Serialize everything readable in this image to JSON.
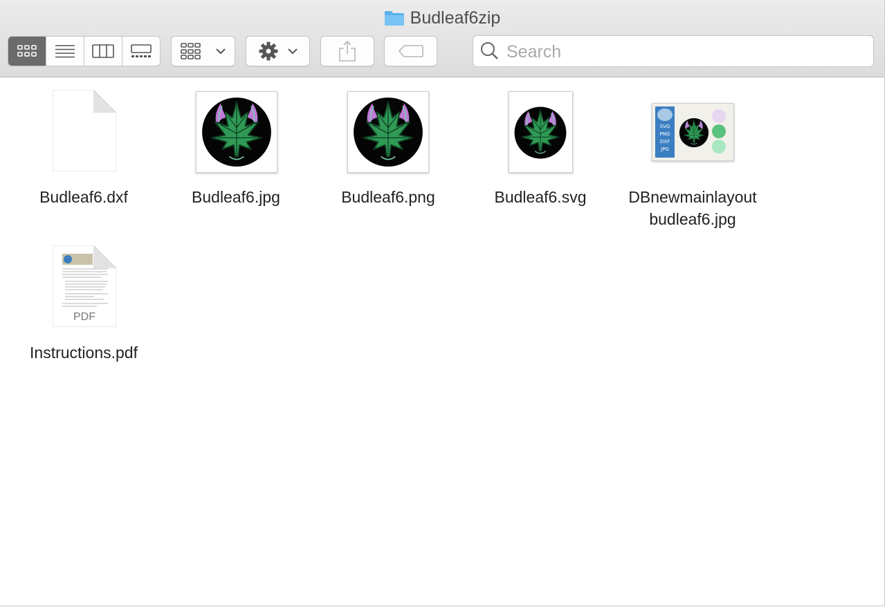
{
  "window": {
    "title": "Budleaf6zip"
  },
  "toolbar": {
    "view_modes": [
      {
        "name": "icon-view",
        "active": true
      },
      {
        "name": "list-view",
        "active": false
      },
      {
        "name": "column-view",
        "active": false
      },
      {
        "name": "gallery-view",
        "active": false
      }
    ],
    "group_button_icon": "grid-icon",
    "action_button_icon": "gear-icon",
    "share_button_icon": "share-icon",
    "tag_button_icon": "tag-icon"
  },
  "search": {
    "placeholder": "Search",
    "value": ""
  },
  "files": [
    {
      "name": "Budleaf6.dxf",
      "kind": "blank-document"
    },
    {
      "name": "Budleaf6.jpg",
      "kind": "leaf-image"
    },
    {
      "name": "Budleaf6.png",
      "kind": "leaf-image"
    },
    {
      "name": "Budleaf6.svg",
      "kind": "leaf-image"
    },
    {
      "name_line1": "DBnewmainlayout",
      "name_line2": "budleaf6.jpg",
      "kind": "layout-image",
      "thumb_labels": [
        "SVG",
        "PNG",
        "DXF",
        "JPG"
      ]
    },
    {
      "name": "Instructions.pdf",
      "kind": "pdf-document",
      "badge": "PDF"
    }
  ],
  "colors": {
    "leaf_green": "#2f9a55",
    "leaf_dark": "#0f3d22",
    "purple": "#c07ad8",
    "active_segment": "#6b6b6b",
    "folder_blue": "#5ab1ec"
  }
}
